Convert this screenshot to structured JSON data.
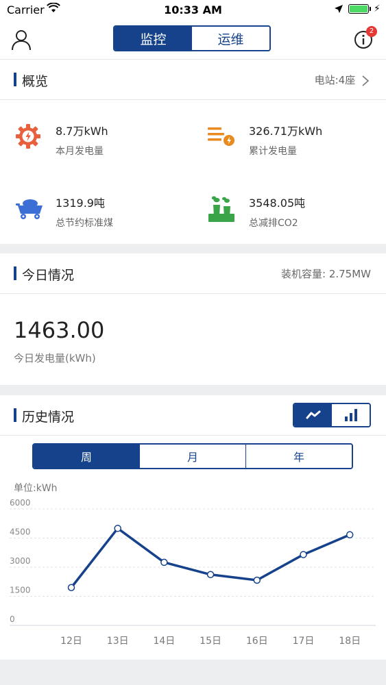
{
  "status": {
    "carrier": "Carrier",
    "time": "10:33 AM"
  },
  "nav": {
    "tabs": [
      {
        "label": "监控",
        "active": true
      },
      {
        "label": "运维",
        "active": false
      }
    ],
    "info_badge": "2"
  },
  "overview": {
    "title": "概览",
    "station": "电站:4座",
    "stats": [
      {
        "value": "8.7万kWh",
        "label": "本月发电量",
        "icon": "power-gear-icon"
      },
      {
        "value": "326.71万kWh",
        "label": "累计发电量",
        "icon": "cumulative-energy-icon"
      },
      {
        "value": "1319.9吨",
        "label": "总节约标准煤",
        "icon": "coal-cart-icon"
      },
      {
        "value": "3548.05吨",
        "label": "总减排CO2",
        "icon": "factory-co2-icon"
      }
    ]
  },
  "today": {
    "title": "今日情况",
    "capacity": "装机容量: 2.75MW",
    "value": "1463.00",
    "label": "今日发电量(kWh)"
  },
  "history": {
    "title": "历史情况",
    "periods": [
      {
        "label": "周",
        "active": true
      },
      {
        "label": "月",
        "active": false
      },
      {
        "label": "年",
        "active": false
      }
    ],
    "unit": "单位:kWh"
  },
  "colors": {
    "primary": "#15428a",
    "badge": "#e53935",
    "gear": "#e8603c",
    "energy": "#e98a1f",
    "coal": "#3b6fd6",
    "factory": "#3aa548"
  },
  "chart_data": {
    "type": "line",
    "categories": [
      "12日",
      "13日",
      "14日",
      "15日",
      "16日",
      "17日",
      "18日"
    ],
    "values": [
      1950,
      5000,
      3250,
      2620,
      2330,
      3650,
      4670
    ],
    "yticks": [
      0,
      1500,
      3000,
      4500,
      6000
    ],
    "ylim": [
      0,
      6000
    ],
    "grid": true
  }
}
